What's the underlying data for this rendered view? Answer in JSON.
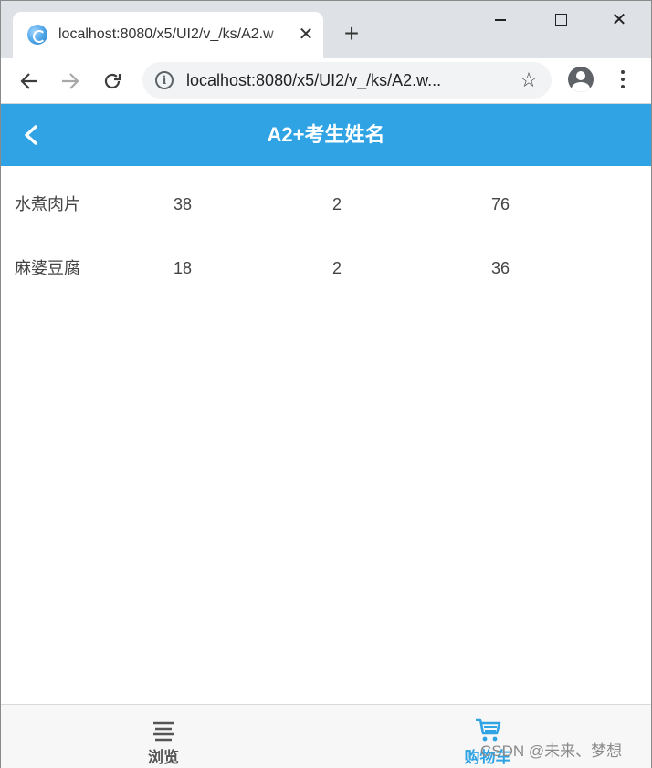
{
  "browser": {
    "tab_title": "localhost:8080/x5/UI2/v_/ks/A2.w",
    "url": "localhost:8080/x5/UI2/v_/ks/A2.w..."
  },
  "app": {
    "title": "A2+考生姓名"
  },
  "items": [
    {
      "name": "水煮肉片",
      "price": "38",
      "quantity": "2",
      "total": "76"
    },
    {
      "name": "麻婆豆腐",
      "price": "18",
      "quantity": "2",
      "total": "36"
    }
  ],
  "tabbar": {
    "browse_label": "浏览",
    "cart_label": "购物车",
    "active": "cart"
  },
  "watermark": "CSDN @未来、梦想",
  "colors": {
    "accent": "#2fa3e4",
    "header_text": "#ffffff",
    "body_text": "#444444"
  }
}
